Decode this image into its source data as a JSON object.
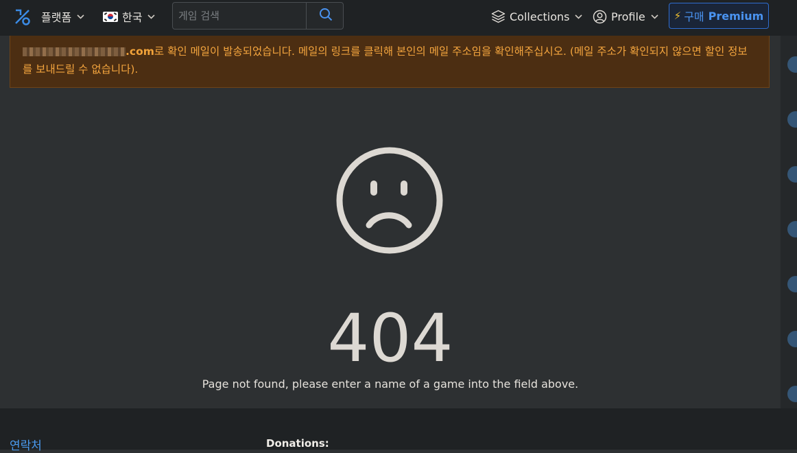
{
  "nav": {
    "platform_label": "플랫폼",
    "language_label": "한국",
    "collections_label": "Collections",
    "profile_label": "Profile",
    "premium_buy": "구매",
    "premium_label": "Premium"
  },
  "search": {
    "placeholder": "게임 검색"
  },
  "alert": {
    "email_domain": ".com",
    "message": "로 확인 메일이 발송되었습니다. 메일의 링크를 클릭해 본인의 메일 주소임을 확인해주십시오. (메일 주소가 확인되지 않으면 할인 정보를 보내드릴 수 없습니다)."
  },
  "error": {
    "code": "404",
    "message": "Page not found, please enter a name of a game into the field above."
  },
  "footer": {
    "contact_label": "연락처",
    "donations_label": "Donations:"
  },
  "colors": {
    "background": "#2d3032",
    "topbar": "#1f2224",
    "alert_bg": "#4c2e12",
    "alert_text": "#f4a53e",
    "accent": "#4a93f0"
  },
  "icons": [
    "logo-icon",
    "flag-kr-icon",
    "search-icon",
    "layers-icon",
    "user-circle-icon",
    "bolt-icon",
    "sad-face-icon",
    "chevron-down-icon"
  ]
}
